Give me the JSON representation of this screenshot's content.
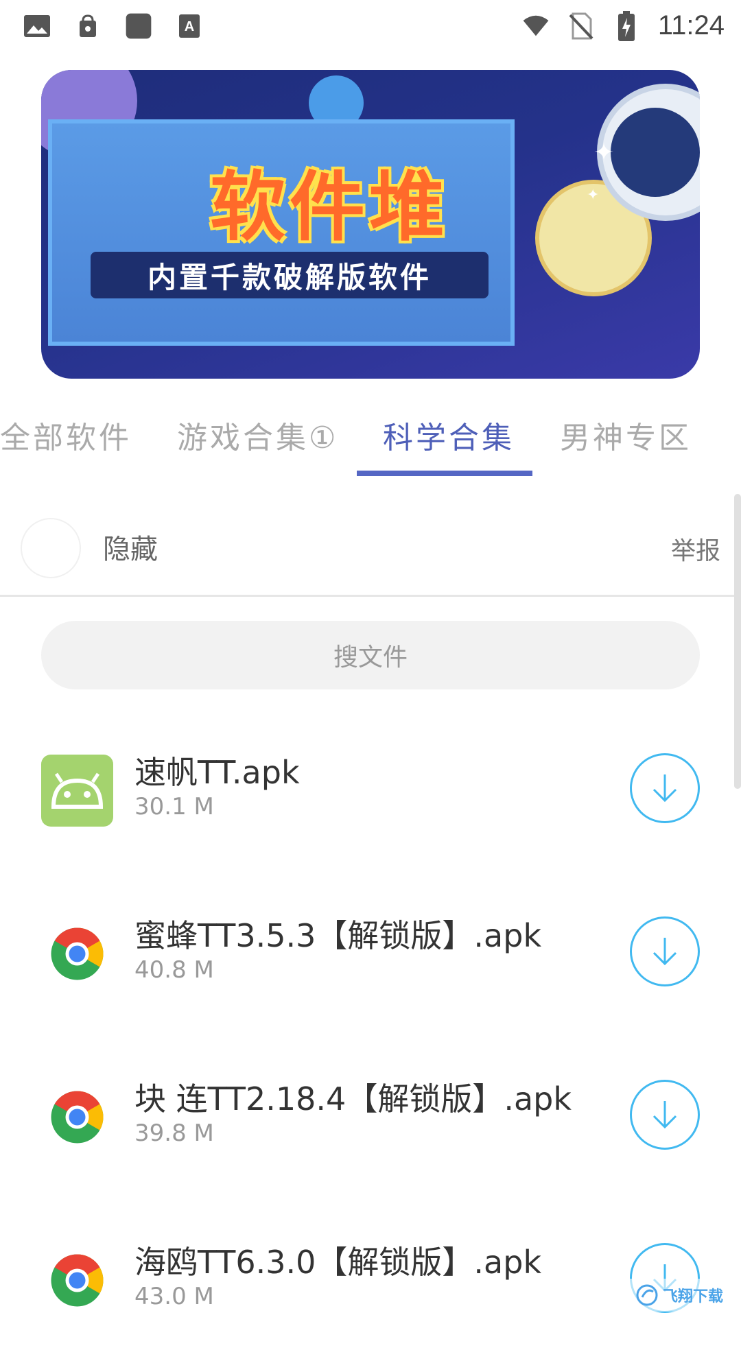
{
  "status_bar": {
    "time": "11:24",
    "left_icons": [
      "image-icon",
      "lock-bag-icon",
      "square-icon",
      "keyboard-a-icon"
    ],
    "right_icons": [
      "wifi-icon",
      "no-sim-icon",
      "battery-charging-icon"
    ]
  },
  "banner": {
    "title": "软件堆",
    "subtitle": "内置千款破解版软件"
  },
  "tabs": [
    {
      "label": "全部软件",
      "active": false
    },
    {
      "label": "游戏合集①",
      "active": false
    },
    {
      "label": "科学合集",
      "active": true
    },
    {
      "label": "男神专区",
      "active": false
    }
  ],
  "hide_row": {
    "label": "隐藏",
    "report": "举报"
  },
  "search": {
    "placeholder": "搜文件"
  },
  "files": [
    {
      "name": "速帆TT.apk",
      "size": "30.1 M",
      "icon": "android-icon"
    },
    {
      "name": "蜜蜂TT3.5.3【解锁版】.apk",
      "size": "40.8 M",
      "icon": "chrome-icon"
    },
    {
      "name": "块 连TT2.18.4【解锁版】.apk",
      "size": "39.8 M",
      "icon": "chrome-icon"
    },
    {
      "name": "海鸥TT6.3.0【解锁版】.apk",
      "size": "43.0 M",
      "icon": "chrome-icon"
    }
  ],
  "watermark": {
    "text": "飞翔下载"
  },
  "colors": {
    "tab_active": "#4e5fb8",
    "tab_inactive": "#aaaaaa",
    "download_accent": "#41b9f0",
    "android_green": "#a4d36e"
  }
}
